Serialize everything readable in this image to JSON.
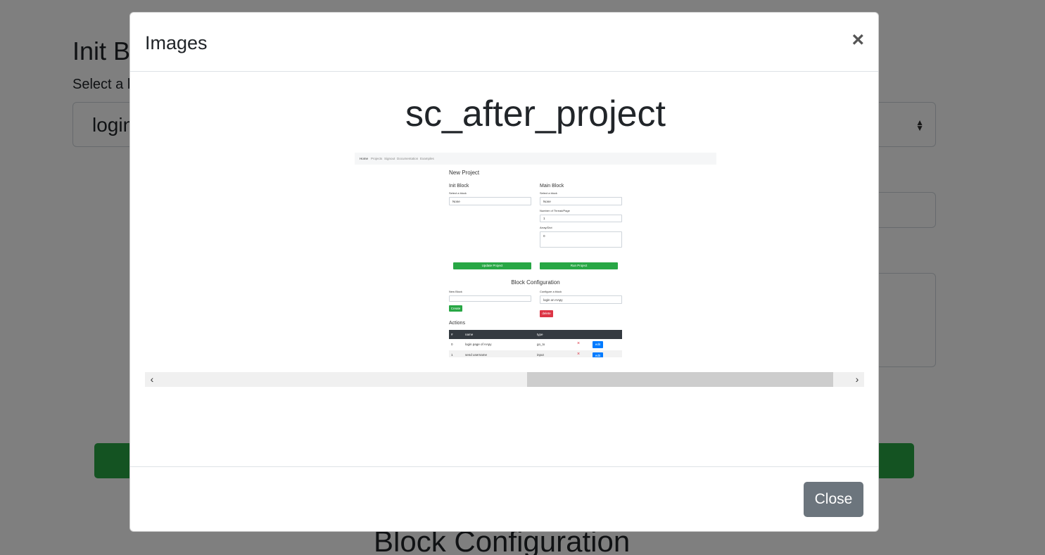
{
  "background": {
    "title": "Init B",
    "select_label": "Select a b",
    "select_value": "login",
    "section_title": "Block Configuration"
  },
  "modal": {
    "title": "Images",
    "close_symbol": "×",
    "image_caption": "sc_after_project",
    "close_button": "Close",
    "scroll_left": "‹",
    "scroll_right": "›"
  },
  "screenshot": {
    "nav": [
      "Home",
      "Projects",
      "Signout",
      "Documentation",
      "Examples"
    ],
    "page_title": "New Project",
    "init_block": {
      "title": "Init Block",
      "select_label": "Select a block",
      "select_value": "None"
    },
    "main_block": {
      "title": "Main Block",
      "select_label": "Select a block",
      "select_value": "None",
      "threads_label": "Number of Thread/Page",
      "threads_value": "1",
      "array_label": "Array/Dict",
      "array_value": "0"
    },
    "update_button": "Update Project",
    "run_button": "Run Project",
    "config_title": "Block Configuration",
    "new_block_label": "New Block",
    "create_button": "Create",
    "configure_label": "Configure a block",
    "configure_value": "login on AApy",
    "delete_button": "delete",
    "actions_title": "Actions",
    "table_headers": [
      "#",
      "name",
      "type"
    ],
    "rows": [
      {
        "index": "0",
        "name": "login page of AApy",
        "type": "go_to",
        "edit": "edit"
      },
      {
        "index": "1",
        "name": "send username",
        "type": "input",
        "edit": "edit"
      }
    ]
  }
}
